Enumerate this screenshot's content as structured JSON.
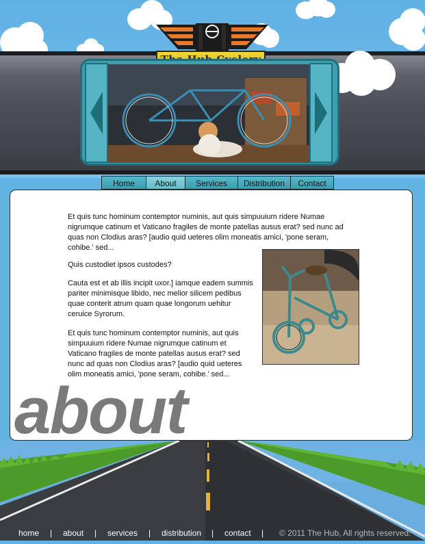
{
  "logo": {
    "title": "The Hub Cyclery"
  },
  "nav": {
    "items": [
      "Home",
      "About",
      "Services",
      "Distribution",
      "Contact"
    ],
    "active": "About"
  },
  "content": {
    "paragraphs": [
      "Et quis tunc hominum contemptor numinis, aut quis simpuuium ridere Numae nigrumque catinum et Vaticano fragiles de monte patellas ausus erat? sed nunc ad quas non Clodius aras? [audio quid ueteres olim moneatis amici, 'pone seram, cohibe.' sed...",
      "Quis custodiet ipsos custodes?",
      "Cauta est et ab illis incipit uxor.] iamque eadem summis pariter minimisque libido, nec melior silicem pedibus quae conterit atrum quam quae longorum uehitur ceruice Syrorum.",
      "Et quis tunc hominum contemptor numinis, aut quis simpuuium ridere Numae nigrumque catinum et Vaticano fragiles de monte patellas ausus erat? sed nunc ad quas non Clodius aras? [audio quid ueteres olim moneatis amici, 'pone seram, cohibe.' sed..."
    ],
    "page_word": "about"
  },
  "footer": {
    "links": [
      "home",
      "about",
      "services",
      "distribution",
      "contact"
    ],
    "separator": "|",
    "copyright": "© 2011 The Hub, All rights reserved."
  },
  "colors": {
    "sky": "#63b3e2",
    "teal": "#3e9fae",
    "band": "#4b4f57",
    "logo_orange": "#e8792c",
    "logo_yellow": "#f4dc3a"
  }
}
